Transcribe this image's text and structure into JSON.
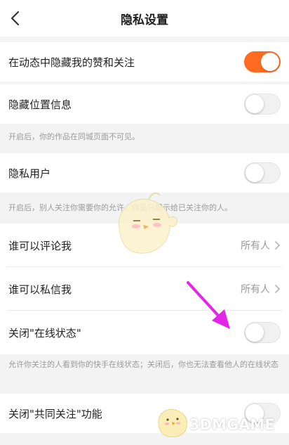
{
  "header": {
    "title": "隐私设置",
    "back_icon": "chevron-left-icon"
  },
  "rows": {
    "hide_likes": {
      "label": "在动态中隐藏我的赞和关注",
      "enabled": true
    },
    "hide_location": {
      "label": "隐藏位置信息",
      "enabled": false,
      "note": "开启后，你的作品在同城页面不可见。"
    },
    "private_user": {
      "label": "隐私用户",
      "enabled": false,
      "note": "开启后，别人关注你需要你的允许，作品只展示给已关注你的人。"
    },
    "who_comment": {
      "label": "谁可以评论我",
      "value": "所有人"
    },
    "who_message": {
      "label": "谁可以私信我",
      "value": "所有人"
    },
    "online_status": {
      "label": "关闭\"在线状态\"",
      "enabled": false,
      "note": "允许你关注的人看到你的快手在线状态；关闭后，你也无法查看他人的在线状态"
    },
    "mutual_follow": {
      "label": "关闭\"共同关注\"功能",
      "enabled": false
    }
  },
  "colors": {
    "accent": "#ff6a21",
    "arrow": "#e325e8"
  },
  "watermark": {
    "text": "3DMGAME"
  }
}
